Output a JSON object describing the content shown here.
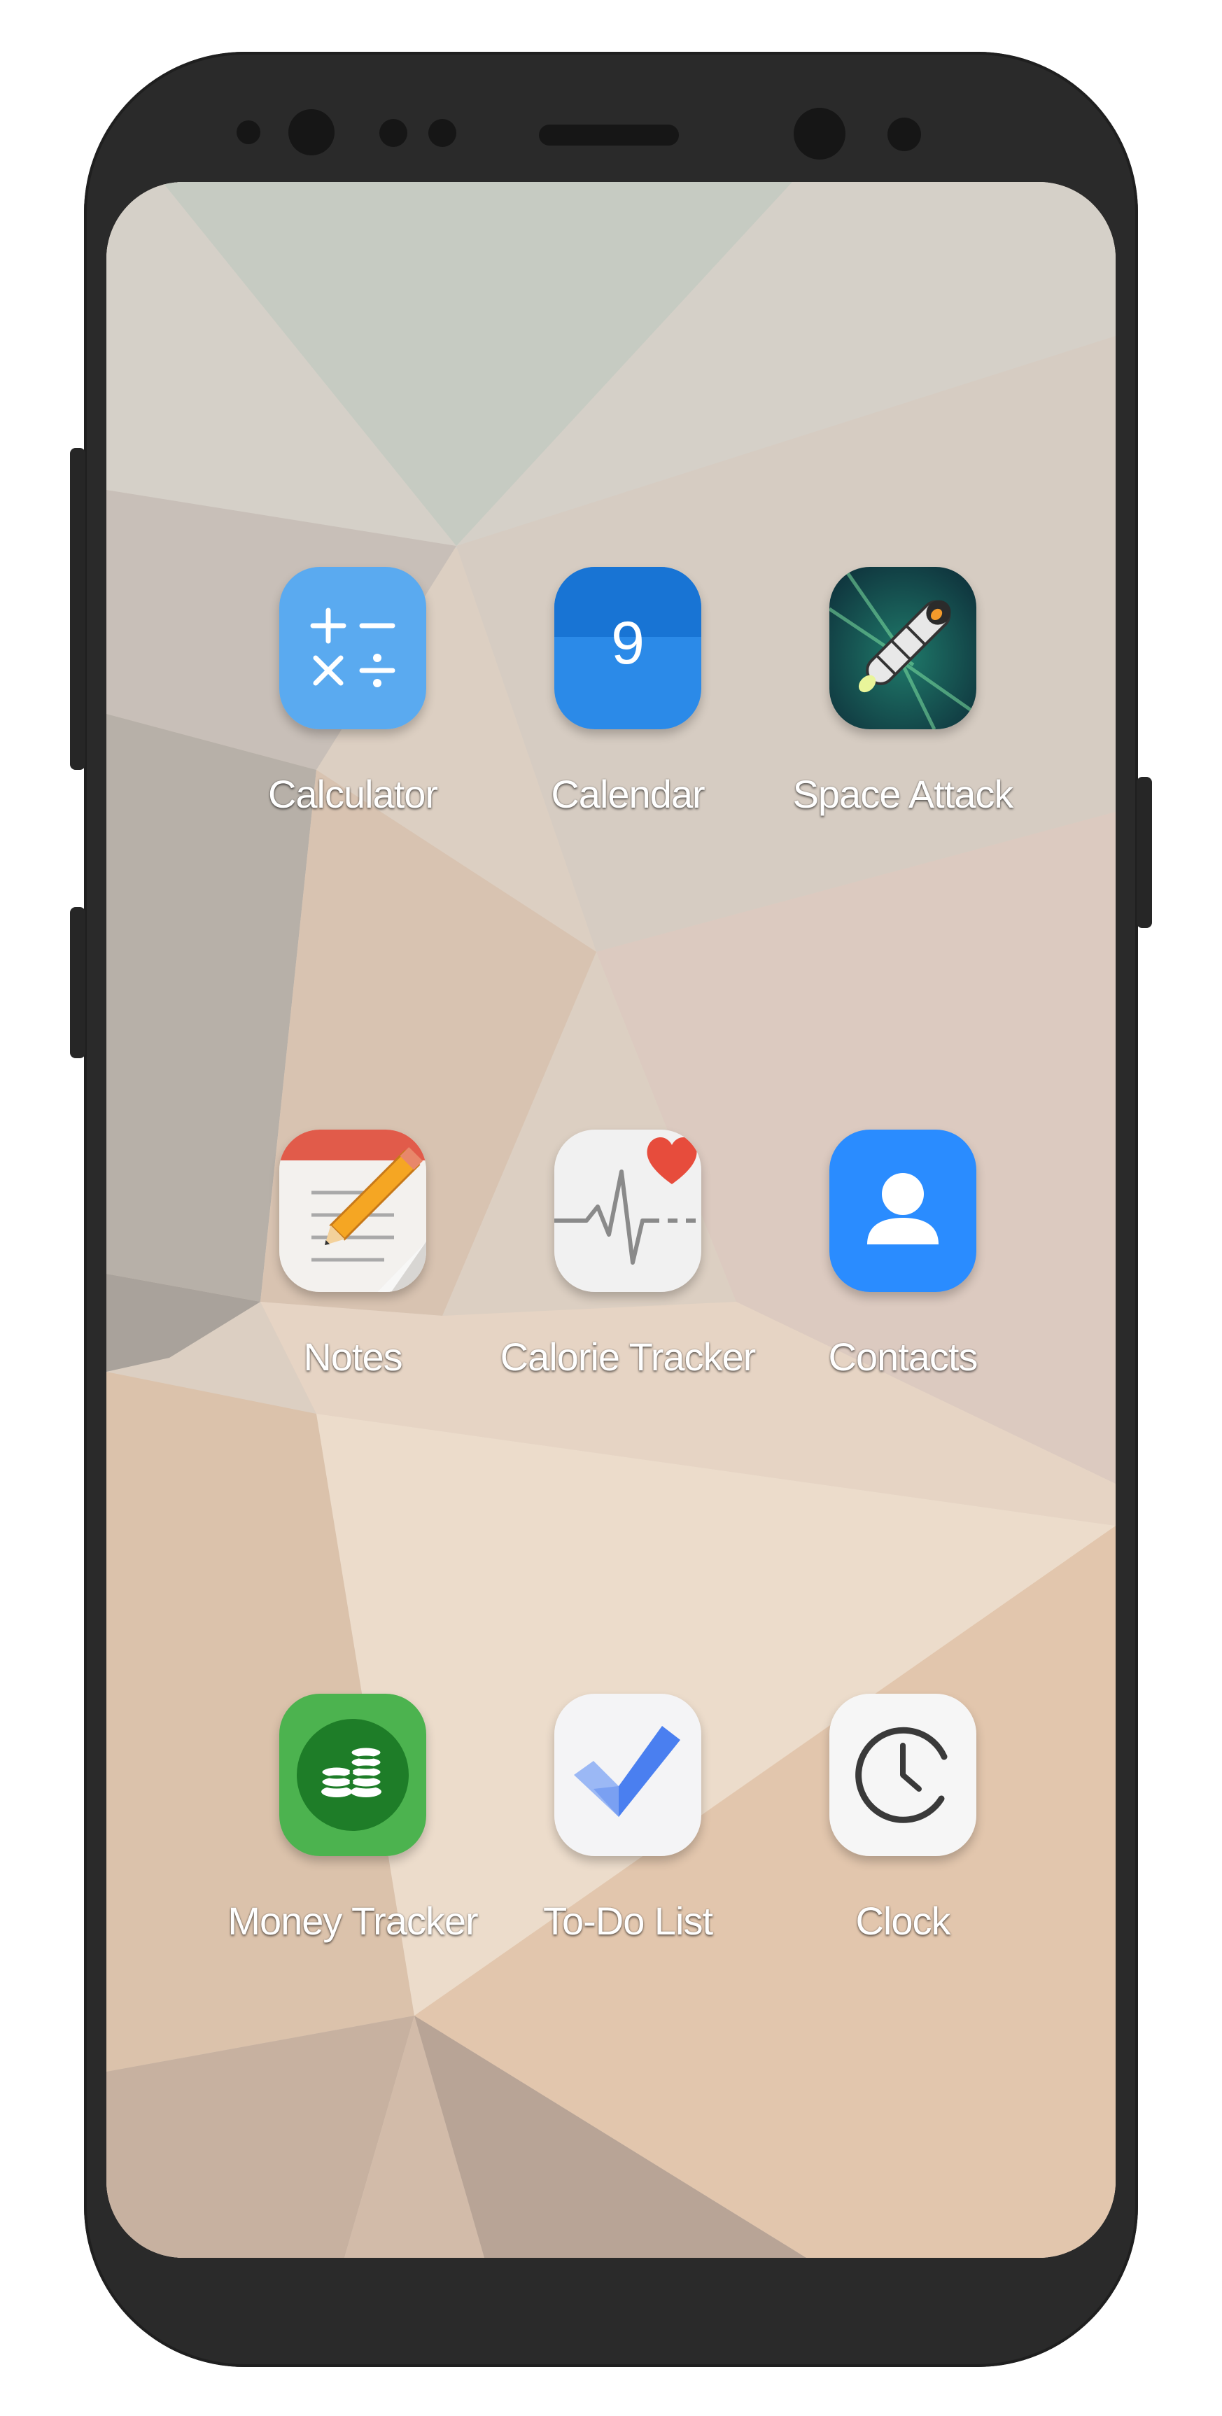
{
  "apps": [
    {
      "label": "Calculator",
      "icon": "calculator-icon"
    },
    {
      "label": "Calendar",
      "icon": "calendar-icon",
      "day": "9"
    },
    {
      "label": "Space Attack",
      "icon": "rocket-icon"
    },
    {
      "label": "Notes",
      "icon": "notes-icon"
    },
    {
      "label": "Calorie Tracker",
      "icon": "heart-pulse-icon"
    },
    {
      "label": "Contacts",
      "icon": "person-icon"
    },
    {
      "label": "Money Tracker",
      "icon": "coins-icon"
    },
    {
      "label": "To-Do List",
      "icon": "checkmark-icon"
    },
    {
      "label": "Clock",
      "icon": "clock-icon"
    }
  ],
  "colors": {
    "phone_body": "#2a2a2a",
    "calculator": "#5aaaf0",
    "calendar": "#1e7fe0",
    "contacts": "#2a8cff",
    "money": "#2f9e3e"
  }
}
